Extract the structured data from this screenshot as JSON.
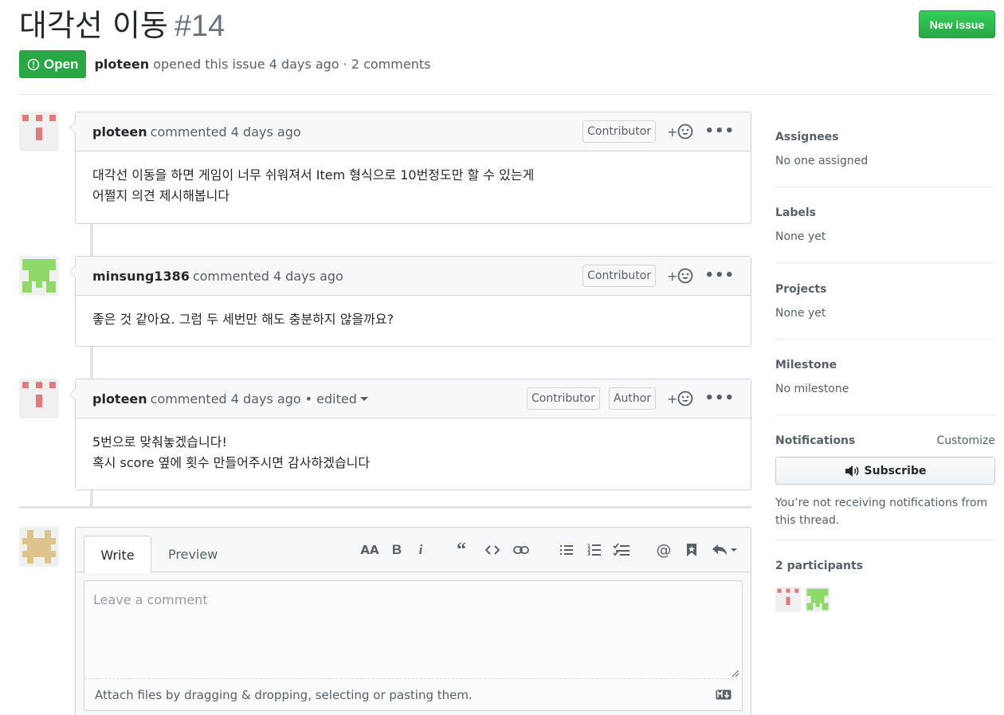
{
  "issue": {
    "title": "대각선 이동",
    "number": "#14",
    "state": "Open",
    "author": "ploteen",
    "opened_text": "opened this issue 4 days ago · 2 comments",
    "new_issue_label": "New issue"
  },
  "comments": [
    {
      "author": "ploteen",
      "meta": "commented 4 days ago",
      "badges": [
        "Contributor"
      ],
      "body": [
        "대각선 이동을 하면 게임이 너무 쉬워져서 Item 형식으로 10번정도만 할 수 있는게",
        "어쩔지 의견 제시해봅니다"
      ]
    },
    {
      "author": "minsung1386",
      "meta": "commented 4 days ago",
      "badges": [
        "Contributor"
      ],
      "body": [
        "좋은 것 같아요. 그럼 두 세번만 해도 충분하지 않을까요?"
      ]
    },
    {
      "author": "ploteen",
      "meta": "commented 4 days ago",
      "edited": "• edited",
      "badges": [
        "Contributor",
        "Author"
      ],
      "body": [
        "5번으로 맞춰놓겠습니다!",
        "혹시 score 옆에 횟수 만들어주시면 감사하겠습니다"
      ]
    }
  ],
  "reaction_label": "+",
  "new_comment": {
    "tab_write": "Write",
    "tab_preview": "Preview",
    "placeholder": "Leave a comment",
    "attach_text": "Attach files by dragging & dropping, selecting or pasting them.",
    "toolbar_icons": [
      "text-size-icon",
      "bold-icon",
      "italic-icon",
      "quote-icon",
      "code-icon",
      "link-icon",
      "bullet-list-icon",
      "numbered-list-icon",
      "task-list-icon",
      "mention-icon",
      "saved-reply-icon",
      "reply-icon"
    ]
  },
  "sidebar": {
    "assignees": {
      "label": "Assignees",
      "value": "No one assigned"
    },
    "labels": {
      "label": "Labels",
      "value": "None yet"
    },
    "projects": {
      "label": "Projects",
      "value": "None yet"
    },
    "milestone": {
      "label": "Milestone",
      "value": "No milestone"
    },
    "notifications": {
      "label": "Notifications",
      "customize": "Customize",
      "subscribe": "Subscribe",
      "note": "You’re not receiving notifications from this thread."
    },
    "participants_label": "2 participants"
  },
  "colors": {
    "green": "#28a745",
    "avatar_red": "#e07b7b",
    "avatar_green": "#8fd86a",
    "avatar_tan": "#dcc48a"
  }
}
